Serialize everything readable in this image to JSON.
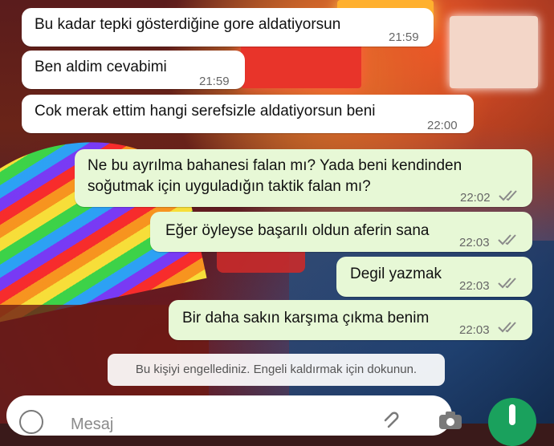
{
  "messages": [
    {
      "text": "Bu kadar tepki gösterdiğine gore aldatiyorsun",
      "time": "21:59"
    },
    {
      "text": "Ben aldim cevabimi",
      "time": "21:59"
    },
    {
      "text": "Cok merak ettim hangi serefsizle aldatiyorsun beni",
      "time": "22:00"
    },
    {
      "text_line1": "Ne bu ayrılma bahanesi falan mı? Yada beni kendinden",
      "text_line2": "soğutmak için uyguladığın taktik falan mı?",
      "time": "22:02"
    },
    {
      "text": "Eğer öyleyse başarılı oldun aferin sana",
      "time": "22:03"
    },
    {
      "text": "Degil yazmak",
      "time": "22:03"
    },
    {
      "text": "Bir daha sakın karşıma çıkma benim",
      "time": "22:03"
    }
  ],
  "system_notice": "Bu kişiyi engellediniz. Engeli kaldırmak için dokunun.",
  "composer": {
    "placeholder": "Mesaj"
  },
  "icons": {
    "read_receipt": "double-check-icon",
    "emoji": "emoji-icon",
    "attach": "paperclip-icon",
    "camera": "camera-icon",
    "mic": "mic-icon"
  },
  "colors": {
    "incoming_bubble": "#ffffff",
    "outgoing_bubble": "#e7f8d6",
    "accent": "#1aa15d",
    "tick": "#8a8a8a"
  }
}
